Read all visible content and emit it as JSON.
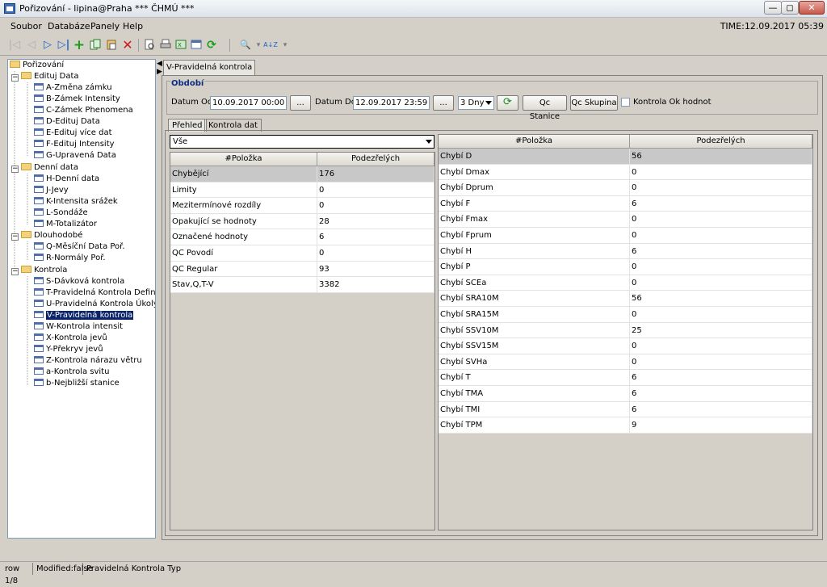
{
  "window": {
    "title": "Pořizování - lipina@Praha *** ČHMÚ ***",
    "controls": {
      "minimize": "—",
      "maximize": "◻",
      "close": "✕"
    }
  },
  "menubar": {
    "items": [
      "Soubor",
      "Databáze",
      "Panely",
      "Help"
    ],
    "time": "TIME:12.09.2017 05:39"
  },
  "toolbar": {
    "icons": [
      "first-icon",
      "previous-icon",
      "next-icon",
      "last-icon",
      "add-icon",
      "copy-icon",
      "paste-icon",
      "delete-icon",
      "print-preview-icon",
      "print-icon",
      "export-icon",
      "window-icon",
      "refresh-icon",
      "search-icon",
      "sort-icon"
    ],
    "glyphs": {
      "first": "|◁",
      "prev": "◁",
      "next": "▷",
      "last": "▷|",
      "add": "+",
      "delete": "✕",
      "refresh": "⟳",
      "search": "🔍",
      "sort": "A↓Z",
      "dropdown": "▾"
    }
  },
  "tree": {
    "root": "Pořizování",
    "groups": [
      {
        "label": "Edituj Data",
        "items": [
          "A-Změna zámku",
          "B-Zámek Intensity",
          "C-Zámek Phenomena",
          "D-Edituj Data",
          "E-Edituj více dat",
          "F-Edituj Intensity",
          "G-Upravená Data"
        ]
      },
      {
        "label": "Denní data",
        "items": [
          "H-Denní data",
          "J-Jevy",
          "K-Intensita srážek",
          "L-Sondáže",
          "M-Totalizátor"
        ]
      },
      {
        "label": "Dlouhodobé",
        "items": [
          "Q-Měsíční Data Poř.",
          "R-Normály Poř."
        ]
      },
      {
        "label": "Kontrola",
        "items": [
          "S-Dávková kontrola",
          "T-Pravidelná Kontrola Definice",
          "U-Pravidelná Kontrola Úkoly",
          "V-Pravidelná kontrola",
          "W-Kontrola intensit",
          "X-Kontrola jevů",
          "Y-Překryv jevů",
          "Z-Kontrola nárazu větru",
          "a-Kontrola svitu",
          "b-Nejbližší stanice"
        ]
      }
    ],
    "selected": "V-Pravidelná kontrola"
  },
  "panel": {
    "tab_label": "V-Pravidelná kontrola",
    "period": {
      "title": "Období",
      "from_label": "Datum Od",
      "from_value": "10.09.2017 00:00",
      "to_label": "Datum Do",
      "to_value": "12.09.2017 23:59",
      "browse_label": "...",
      "range_value": "3 Dny",
      "qc_station_label": "Qc Stanice",
      "qc_group_label": "Qc Skupina",
      "ok_checkbox_label": "Kontrola Ok hodnot",
      "ok_checkbox_checked": false
    },
    "subtabs": [
      "Přehled",
      "Kontrola dat"
    ],
    "active_subtab": "Přehled",
    "filter_value": "Vše"
  },
  "left_table": {
    "columns": [
      "#Položka",
      "Podezřelých"
    ],
    "rows": [
      [
        "Chybějící",
        "176"
      ],
      [
        "Limity",
        "0"
      ],
      [
        "Mezitermínové rozdíly",
        "0"
      ],
      [
        "Opakující se hodnoty",
        "28"
      ],
      [
        "Označené hodnoty",
        "6"
      ],
      [
        "QC Povodí",
        "0"
      ],
      [
        "QC Regular",
        "93"
      ],
      [
        "Stav,Q,T-V",
        "3382"
      ]
    ],
    "selected_row": 0
  },
  "right_table": {
    "columns": [
      "#Položka",
      "Podezřelých"
    ],
    "rows": [
      [
        "Chybí D",
        "56"
      ],
      [
        "Chybí Dmax",
        "0"
      ],
      [
        "Chybí Dprum",
        "0"
      ],
      [
        "Chybí F",
        "6"
      ],
      [
        "Chybí Fmax",
        "0"
      ],
      [
        "Chybí Fprum",
        "0"
      ],
      [
        "Chybí H",
        "6"
      ],
      [
        "Chybí P",
        "0"
      ],
      [
        "Chybí SCEa",
        "0"
      ],
      [
        "Chybí SRA10M",
        "56"
      ],
      [
        "Chybí SRA15M",
        "0"
      ],
      [
        "Chybí SSV10M",
        "25"
      ],
      [
        "Chybí SSV15M",
        "0"
      ],
      [
        "Chybí SVHa",
        "0"
      ],
      [
        "Chybí T",
        "6"
      ],
      [
        "Chybí TMA",
        "6"
      ],
      [
        "Chybí TMI",
        "6"
      ],
      [
        "Chybí TPM",
        "9"
      ]
    ],
    "selected_row": 0
  },
  "statusbar": {
    "row": "row 1/8",
    "modified": "Modified:false",
    "context": "Pravidelná Kontrola Typ"
  }
}
